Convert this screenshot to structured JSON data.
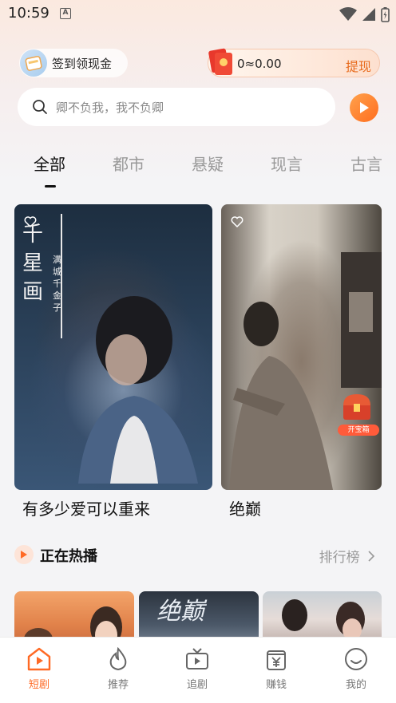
{
  "status_bar": {
    "time": "10:59",
    "indicator": "A"
  },
  "header": {
    "checkin_label": "签到领现金",
    "cash_amount": "0≈0.00",
    "withdraw_label": "提现"
  },
  "search": {
    "placeholder": "卿不负我，我不负卿"
  },
  "tabs": [
    {
      "label": "全部",
      "active": true
    },
    {
      "label": "都市",
      "active": false
    },
    {
      "label": "悬疑",
      "active": false
    },
    {
      "label": "现言",
      "active": false
    },
    {
      "label": "古言",
      "active": false
    }
  ],
  "featured": [
    {
      "title": "有多少爱可以重来",
      "poster_title": "千星画",
      "poster_subtitle": "满城千金子"
    },
    {
      "title": "绝巅",
      "badge": "开宝箱"
    }
  ],
  "hot_section": {
    "title": "正在热播",
    "more_label": "排行榜",
    "thumb2_text": "绝巅"
  },
  "bottom_nav": [
    {
      "label": "短剧",
      "icon": "home-play-icon",
      "active": true
    },
    {
      "label": "推荐",
      "icon": "flame-icon",
      "active": false
    },
    {
      "label": "追剧",
      "icon": "tv-icon",
      "active": false
    },
    {
      "label": "赚钱",
      "icon": "yen-wallet-icon",
      "active": false
    },
    {
      "label": "我的",
      "icon": "smile-icon",
      "active": false
    }
  ],
  "colors": {
    "accent": "#ff6a25",
    "withdraw": "#e86a1c"
  }
}
